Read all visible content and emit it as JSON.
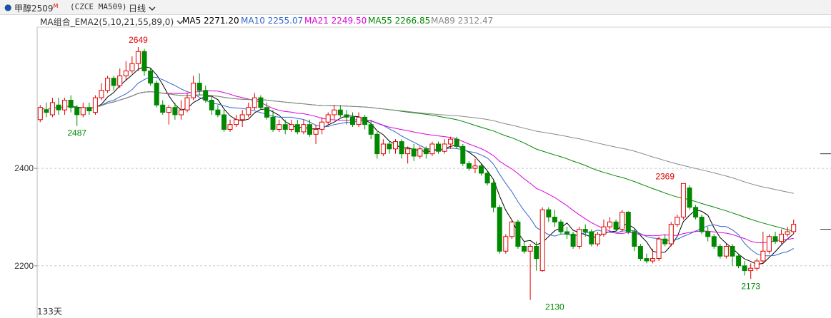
{
  "header": {
    "symbol": "甲醇2509",
    "superscript": "M",
    "code": "(CZCE MA509)",
    "period": "日线",
    "period_icon": "chevron-down-icon"
  },
  "legend": {
    "indicator": "MA组合_EMA2(5,10,21,55,89,0)",
    "indicator_icon": "chevron-down-icon",
    "items": [
      {
        "label": "MA5 2271.20",
        "color": "#000000"
      },
      {
        "label": "MA10 2255.07",
        "color": "#3366cc"
      },
      {
        "label": "MA21 2249.50",
        "color": "#dd00dd"
      },
      {
        "label": "MA55 2266.85",
        "color": "#008800"
      },
      {
        "label": "MA89 2312.47",
        "color": "#888888"
      }
    ]
  },
  "footer": {
    "days": "133天"
  },
  "chart_data": {
    "type": "candlestick",
    "y_ticks": [
      2200,
      2400
    ],
    "y_range": [
      2128,
      2690
    ],
    "up_color": "#e00000",
    "down_color": "#008800",
    "gridlines": "dashed-horizontal",
    "peak_labels": [
      {
        "text": "2649",
        "index": 16,
        "value": 2649,
        "color": "#e00000",
        "position": "above"
      },
      {
        "text": "2487",
        "index": 6,
        "value": 2487,
        "color": "#008800",
        "position": "below"
      },
      {
        "text": "2130",
        "index": 84,
        "value": 2130,
        "color": "#008800",
        "position": "below"
      },
      {
        "text": "2369",
        "index": 102,
        "value": 2369,
        "color": "#e00000",
        "position": "above"
      },
      {
        "text": "2173",
        "index": 116,
        "value": 2173,
        "color": "#008800",
        "position": "below"
      }
    ],
    "candles": [
      [
        2500,
        2525,
        2495,
        2530
      ],
      [
        2520,
        2515,
        2505,
        2535
      ],
      [
        2510,
        2535,
        2505,
        2545
      ],
      [
        2530,
        2520,
        2510,
        2545
      ],
      [
        2520,
        2540,
        2510,
        2545
      ],
      [
        2540,
        2525,
        2515,
        2550
      ],
      [
        2525,
        2510,
        2487,
        2530
      ],
      [
        2510,
        2525,
        2505,
        2535
      ],
      [
        2525,
        2518,
        2510,
        2535
      ],
      [
        2515,
        2545,
        2510,
        2550
      ],
      [
        2545,
        2560,
        2540,
        2575
      ],
      [
        2560,
        2585,
        2555,
        2590
      ],
      [
        2585,
        2570,
        2560,
        2590
      ],
      [
        2570,
        2590,
        2565,
        2605
      ],
      [
        2590,
        2600,
        2580,
        2620
      ],
      [
        2600,
        2615,
        2595,
        2630
      ],
      [
        2615,
        2640,
        2600,
        2649
      ],
      [
        2640,
        2600,
        2590,
        2645
      ],
      [
        2600,
        2575,
        2570,
        2605
      ],
      [
        2575,
        2530,
        2525,
        2580
      ],
      [
        2530,
        2515,
        2510,
        2540
      ],
      [
        2515,
        2525,
        2490,
        2530
      ],
      [
        2525,
        2510,
        2500,
        2535
      ],
      [
        2510,
        2520,
        2500,
        2540
      ],
      [
        2520,
        2545,
        2515,
        2555
      ],
      [
        2545,
        2575,
        2540,
        2590
      ],
      [
        2575,
        2560,
        2550,
        2595
      ],
      [
        2560,
        2540,
        2535,
        2570
      ],
      [
        2540,
        2520,
        2510,
        2550
      ],
      [
        2520,
        2510,
        2505,
        2530
      ],
      [
        2510,
        2480,
        2475,
        2520
      ],
      [
        2480,
        2490,
        2475,
        2500
      ],
      [
        2490,
        2500,
        2485,
        2510
      ],
      [
        2500,
        2510,
        2485,
        2520
      ],
      [
        2510,
        2525,
        2505,
        2535
      ],
      [
        2525,
        2545,
        2520,
        2555
      ],
      [
        2545,
        2525,
        2520,
        2550
      ],
      [
        2525,
        2505,
        2500,
        2535
      ],
      [
        2505,
        2480,
        2475,
        2520
      ],
      [
        2480,
        2490,
        2475,
        2500
      ],
      [
        2490,
        2480,
        2470,
        2500
      ],
      [
        2480,
        2490,
        2475,
        2500
      ],
      [
        2490,
        2475,
        2470,
        2500
      ],
      [
        2475,
        2490,
        2470,
        2500
      ],
      [
        2490,
        2470,
        2465,
        2500
      ],
      [
        2470,
        2480,
        2450,
        2490
      ],
      [
        2480,
        2495,
        2470,
        2505
      ],
      [
        2495,
        2510,
        2490,
        2515
      ],
      [
        2510,
        2520,
        2500,
        2530
      ],
      [
        2520,
        2510,
        2505,
        2530
      ],
      [
        2510,
        2505,
        2490,
        2520
      ],
      [
        2505,
        2490,
        2485,
        2515
      ],
      [
        2490,
        2505,
        2485,
        2515
      ],
      [
        2505,
        2490,
        2480,
        2510
      ],
      [
        2490,
        2470,
        2460,
        2500
      ],
      [
        2470,
        2430,
        2420,
        2475
      ],
      [
        2430,
        2450,
        2425,
        2460
      ],
      [
        2450,
        2440,
        2430,
        2455
      ],
      [
        2440,
        2455,
        2430,
        2460
      ],
      [
        2455,
        2430,
        2420,
        2460
      ],
      [
        2430,
        2440,
        2410,
        2445
      ],
      [
        2440,
        2425,
        2415,
        2450
      ],
      [
        2425,
        2440,
        2420,
        2445
      ],
      [
        2440,
        2430,
        2420,
        2445
      ],
      [
        2430,
        2450,
        2425,
        2455
      ],
      [
        2450,
        2435,
        2430,
        2455
      ],
      [
        2435,
        2450,
        2430,
        2460
      ],
      [
        2450,
        2460,
        2440,
        2465
      ],
      [
        2460,
        2445,
        2440,
        2465
      ],
      [
        2445,
        2410,
        2405,
        2450
      ],
      [
        2410,
        2400,
        2395,
        2415
      ],
      [
        2400,
        2405,
        2390,
        2420
      ],
      [
        2405,
        2390,
        2385,
        2410
      ],
      [
        2390,
        2370,
        2365,
        2395
      ],
      [
        2370,
        2320,
        2310,
        2375
      ],
      [
        2320,
        2230,
        2225,
        2325
      ],
      [
        2230,
        2260,
        2225,
        2265
      ],
      [
        2260,
        2290,
        2255,
        2295
      ],
      [
        2290,
        2240,
        2235,
        2295
      ],
      [
        2240,
        2230,
        2225,
        2250
      ],
      [
        2230,
        2240,
        2130,
        2245
      ],
      [
        2240,
        2215,
        2190,
        2250
      ],
      [
        2190,
        2315,
        2188,
        2320
      ],
      [
        2315,
        2300,
        2290,
        2320
      ],
      [
        2300,
        2290,
        2280,
        2315
      ],
      [
        2290,
        2270,
        2265,
        2295
      ],
      [
        2270,
        2265,
        2255,
        2280
      ],
      [
        2265,
        2240,
        2235,
        2270
      ],
      [
        2240,
        2275,
        2235,
        2280
      ],
      [
        2275,
        2270,
        2260,
        2285
      ],
      [
        2270,
        2245,
        2240,
        2275
      ],
      [
        2245,
        2265,
        2240,
        2270
      ],
      [
        2265,
        2280,
        2260,
        2295
      ],
      [
        2280,
        2290,
        2275,
        2300
      ],
      [
        2290,
        2275,
        2270,
        2295
      ],
      [
        2275,
        2310,
        2270,
        2315
      ],
      [
        2310,
        2270,
        2265,
        2312
      ],
      [
        2270,
        2240,
        2230,
        2275
      ],
      [
        2240,
        2215,
        2210,
        2245
      ],
      [
        2215,
        2210,
        2205,
        2225
      ],
      [
        2210,
        2215,
        2205,
        2235
      ],
      [
        2215,
        2255,
        2210,
        2260
      ],
      [
        2255,
        2245,
        2240,
        2265
      ],
      [
        2245,
        2285,
        2240,
        2290
      ],
      [
        2285,
        2300,
        2280,
        2305
      ],
      [
        2300,
        2369,
        2295,
        2369
      ],
      [
        2360,
        2320,
        2315,
        2365
      ],
      [
        2320,
        2300,
        2295,
        2325
      ],
      [
        2300,
        2270,
        2265,
        2305
      ],
      [
        2270,
        2260,
        2250,
        2280
      ],
      [
        2260,
        2240,
        2235,
        2265
      ],
      [
        2240,
        2220,
        2215,
        2245
      ],
      [
        2220,
        2240,
        2215,
        2245
      ],
      [
        2240,
        2220,
        2200,
        2245
      ],
      [
        2220,
        2200,
        2195,
        2225
      ],
      [
        2200,
        2190,
        2180,
        2210
      ],
      [
        2190,
        2195,
        2173,
        2205
      ],
      [
        2195,
        2210,
        2190,
        2215
      ],
      [
        2210,
        2230,
        2205,
        2270
      ],
      [
        2230,
        2260,
        2225,
        2265
      ],
      [
        2260,
        2250,
        2245,
        2270
      ],
      [
        2250,
        2265,
        2245,
        2275
      ],
      [
        2265,
        2270,
        2260,
        2280
      ],
      [
        2270,
        2285,
        2265,
        2295
      ]
    ]
  }
}
